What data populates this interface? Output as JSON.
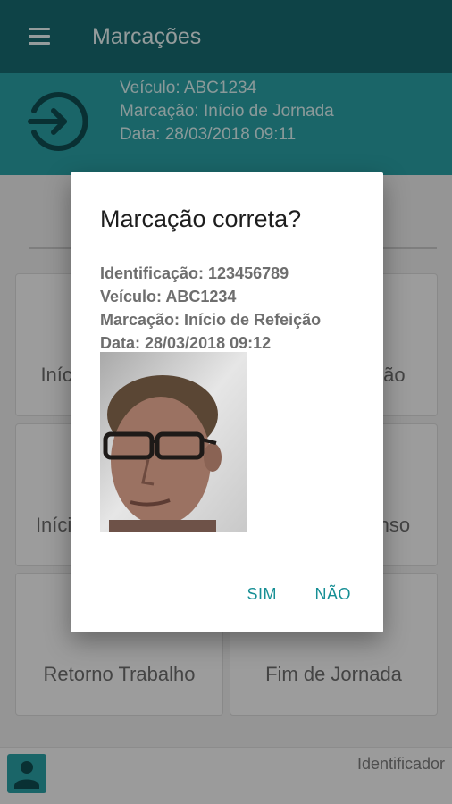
{
  "appbar": {
    "title": "Marcações",
    "menu_icon": "menu-icon"
  },
  "banner": {
    "icon": "login-icon",
    "vehicle": "Veículo: ABC1234",
    "mark": "Marcação: Início de Jornada",
    "date": "Data: 28/03/2018 09:11"
  },
  "tiles": [
    {
      "label": "Início de Refeição"
    },
    {
      "label": "Fim de Refeição"
    },
    {
      "label": "Início de Descanso"
    },
    {
      "label": "Fim de Descanso"
    },
    {
      "label": "Retorno Trabalho"
    },
    {
      "label": "Fim de Jornada"
    }
  ],
  "bottom": {
    "id_label": "Identificador",
    "icon": "user-icon"
  },
  "dialog": {
    "title": "Marcação correta?",
    "identification": "Identificação: 123456789",
    "vehicle": "Veículo: ABC1234",
    "mark": "Marcação: Início de Refeição",
    "date": "Data: 28/03/2018 09:12",
    "yes_label": "SIM",
    "no_label": "NÃO"
  },
  "colors": {
    "appbar": "#176a70",
    "banner": "#2a9ea3",
    "accent": "#178f95"
  }
}
